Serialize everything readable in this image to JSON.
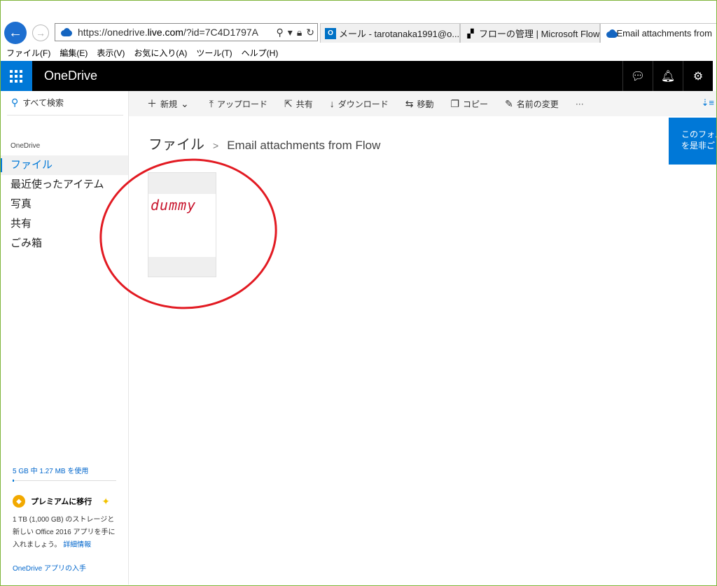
{
  "browser": {
    "url_prefix": "https://onedrive.",
    "url_domain": "live.com",
    "url_suffix": "/?id=7C4D1797A",
    "tabs": [
      {
        "label": "メール - tarotanaka1991@o..."
      },
      {
        "label": "フローの管理 | Microsoft Flow"
      },
      {
        "label": "Email attachments from"
      }
    ],
    "menu": [
      "ファイル(F)",
      "編集(E)",
      "表示(V)",
      "お気に入り(A)",
      "ツール(T)",
      "ヘルプ(H)"
    ]
  },
  "header": {
    "brand": "OneDrive"
  },
  "sidebar": {
    "search_label": "すべて検索",
    "section_label": "OneDrive",
    "items": [
      {
        "label": "ファイル"
      },
      {
        "label": "最近使ったアイテム"
      },
      {
        "label": "写真"
      },
      {
        "label": "共有"
      },
      {
        "label": "ごみ箱"
      }
    ],
    "quota": "5 GB 中 1.27 MB を使用",
    "premium_title": "プレミアムに移行",
    "premium_desc": "1 TB (1,000 GB) のストレージと新しい Office 2016 アプリを手に入れましょう。",
    "premium_link": "詳細情報",
    "app_link": "OneDrive アプリの入手"
  },
  "commands": {
    "new": "新規",
    "upload": "アップロード",
    "share": "共有",
    "download": "ダウンロード",
    "move": "移動",
    "copy": "コピー",
    "rename": "名前の変更",
    "more": "···"
  },
  "breadcrumb": {
    "root": "ファイル",
    "separator": ">",
    "current": "Email attachments from Flow"
  },
  "file_tile": {
    "handwritten_text": "dummy"
  },
  "bubble": {
    "line1": "このフォル",
    "line2": "を是非ご"
  },
  "colors": {
    "accent": "#0078d7",
    "header": "#000000",
    "annotation": "#e21a22"
  }
}
